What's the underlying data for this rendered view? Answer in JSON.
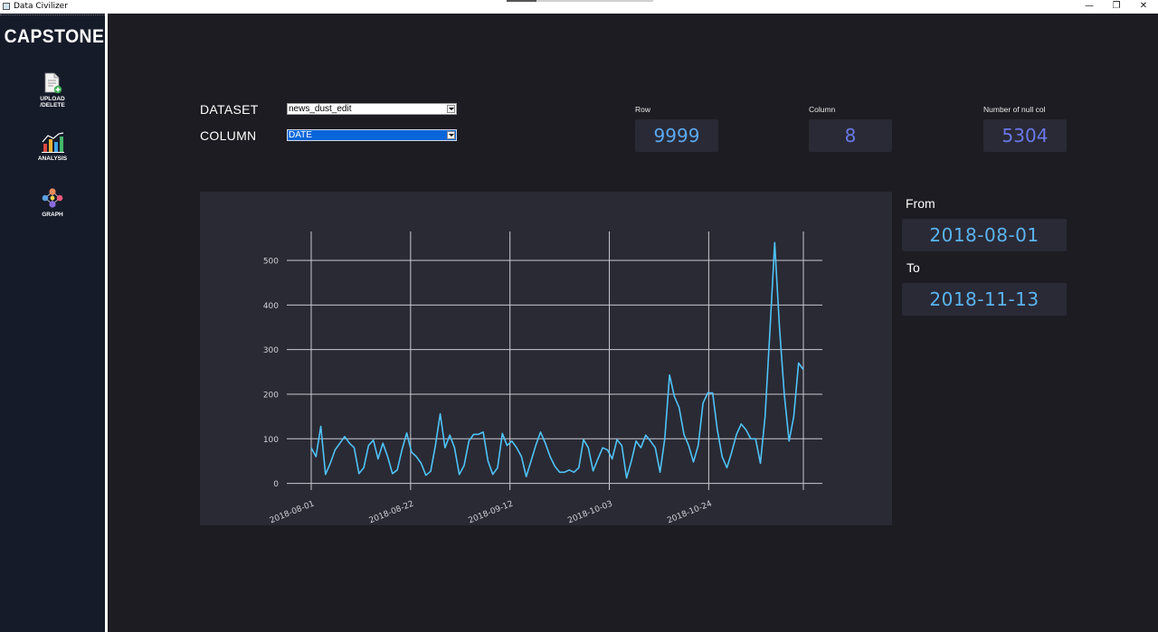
{
  "window": {
    "title": "Data Civilizer",
    "minimize_glyph": "—",
    "restore_glyph": "❐",
    "close_glyph": "✕"
  },
  "sidebar": {
    "brand": "CAPSTONE",
    "items": [
      {
        "label_line1": "UPLOAD",
        "label_line2": "/DELETE",
        "icon": "document-upload-icon"
      },
      {
        "label_line1": "ANALYSIS",
        "label_line2": "",
        "icon": "bar-chart-icon"
      },
      {
        "label_line1": "GRAPH",
        "label_line2": "",
        "icon": "network-graph-icon"
      }
    ]
  },
  "controls": {
    "dataset_label": "DATASET",
    "dataset_value": "news_dust_edit",
    "column_label": "COLUMN",
    "column_value": "DATE"
  },
  "stats": {
    "row_label": "Row",
    "row_value": "9999",
    "column_label": "Column",
    "column_value": "8",
    "null_label": "Number of null col",
    "null_value": "5304"
  },
  "range": {
    "from_label": "From",
    "from_value": "2018-08-01",
    "to_label": "To",
    "to_value": "2018-11-13"
  },
  "colors": {
    "line": "#4fc3f7",
    "grid": "#c8c8d0",
    "axis_text": "#d0d0d8"
  },
  "chart_data": {
    "type": "line",
    "x_start": "2018-08-01",
    "x_end": "2018-11-13",
    "x_ticks": [
      "2018-08-01",
      "2018-08-22",
      "2018-09-12",
      "2018-10-03",
      "2018-10-24"
    ],
    "y_ticks": [
      0,
      100,
      200,
      300,
      400,
      500
    ],
    "ylim": [
      -15,
      565
    ],
    "grid": true,
    "series": [
      {
        "values": [
          80,
          60,
          128,
          20,
          45,
          75,
          90,
          105,
          90,
          80,
          22,
          35,
          85,
          97,
          55,
          90,
          60,
          22,
          30,
          75,
          113,
          70,
          60,
          45,
          18,
          27,
          85,
          156,
          80,
          108,
          80,
          20,
          40,
          95,
          110,
          110,
          115,
          50,
          20,
          35,
          112,
          85,
          95,
          80,
          60,
          15,
          50,
          85,
          115,
          90,
          60,
          38,
          25,
          25,
          30,
          25,
          35,
          98,
          80,
          28,
          55,
          80,
          75,
          55,
          98,
          85,
          12,
          50,
          95,
          80,
          108,
          95,
          80,
          25,
          100,
          243,
          195,
          170,
          110,
          85,
          48,
          85,
          180,
          203,
          203,
          120,
          60,
          35,
          70,
          110,
          133,
          120,
          100,
          100,
          45,
          150,
          340,
          540,
          350,
          200,
          95,
          150,
          270,
          255
        ]
      }
    ]
  }
}
